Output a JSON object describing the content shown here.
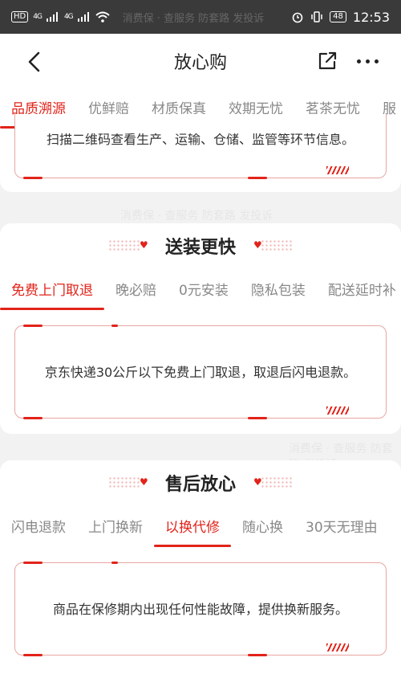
{
  "status_bar": {
    "hd_label": "HD",
    "signal1": "4G",
    "signal2": "4G",
    "watermark": "消费保 · 查服务 防套路 发投诉",
    "battery": "48",
    "time": "12:53"
  },
  "header": {
    "title": "放心购",
    "back_icon": "back-arrow-icon",
    "share_icon": "share-icon",
    "more_icon": "more-icon"
  },
  "section_quality": {
    "tabs": [
      "品质溯源",
      "优鲜赔",
      "材质保真",
      "效期无忧",
      "茗茶无忧",
      "服"
    ],
    "active_tab": 0,
    "card_text": "扫描二维码查看生产、运输、仓储、监管等环节信息。"
  },
  "section_delivery": {
    "title": "送装更快",
    "tabs": [
      "免费上门取退",
      "晚必赔",
      "0元安装",
      "隐私包装",
      "配送延时补"
    ],
    "active_tab": 0,
    "card_text": "京东快递30公斤以下免费上门取退，取退后闪电退款。"
  },
  "section_aftersale": {
    "title": "售后放心",
    "tabs": [
      "闪电退款",
      "上门换新",
      "以换代修",
      "随心换",
      "30天无理由"
    ],
    "active_tab": 2,
    "card_text": "商品在保修期内出现任何性能故障，提供换新服务。"
  },
  "colors": {
    "accent": "#e2231a",
    "status_bar": "#3a3a3a"
  }
}
